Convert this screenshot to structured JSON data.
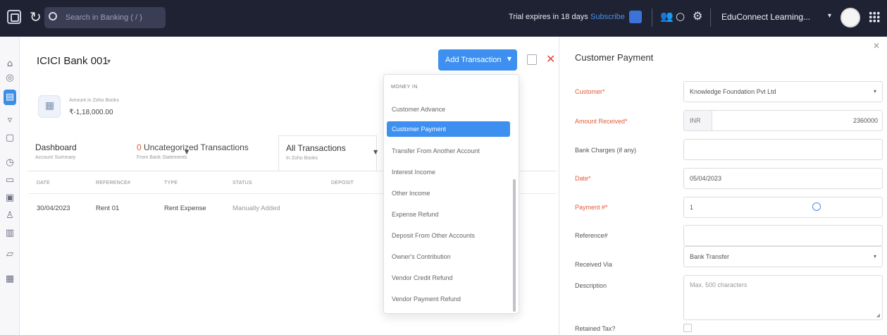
{
  "topbar": {
    "search_placeholder": "Search in Banking ( / )",
    "trial_text": "Trial expires in 18 days",
    "subscribe_label": "Subscribe",
    "org_name": "EduConnect Learning..."
  },
  "sidebar": {
    "icons": [
      "home-icon",
      "shop-icon",
      "bank-icon",
      "cart-icon",
      "bag-icon",
      "clock-icon",
      "receipt-icon",
      "doc-icon",
      "user-icon",
      "report-icon",
      "folder-icon",
      "settings-icon"
    ]
  },
  "main": {
    "bank_title": "ICICI Bank 001",
    "add_transaction_label": "Add Transaction",
    "balance_label": "Amount in Zoho Books",
    "balance_value": "₹-1,18,000.00",
    "tabs": [
      {
        "title": "Dashboard",
        "sub": "Account Summary"
      },
      {
        "count": "0",
        "title": "Uncategorized Transactions",
        "sub": "From Bank Statements"
      },
      {
        "title": "All Transactions",
        "sub": "In Zoho Books"
      }
    ],
    "table": {
      "headers": [
        "DATE",
        "REFERENCE#",
        "TYPE",
        "STATUS",
        "DEPOSIT"
      ],
      "rows": [
        {
          "date": "30/04/2023",
          "reference": "Rent 01",
          "type": "Rent Expense",
          "status": "Manually Added"
        }
      ]
    }
  },
  "dropdown": {
    "header": "MONEY IN",
    "items": [
      "Customer Advance",
      "Customer Payment",
      "Transfer From Another Account",
      "Interest Income",
      "Other Income",
      "Expense Refund",
      "Deposit From Other Accounts",
      "Owner's Contribution",
      "Vendor Credit Refund",
      "Vendor Payment Refund"
    ],
    "selected_index": 1
  },
  "panel": {
    "title": "Customer Payment",
    "fields": {
      "customer_label": "Customer*",
      "customer_value": "Knowledge Foundation Pvt Ltd",
      "amount_label": "Amount Received*",
      "amount_currency": "INR",
      "amount_value": "2360000",
      "bank_charges_label": "Bank Charges (if any)",
      "date_label": "Date*",
      "date_value": "05/04/2023",
      "payment_label": "Payment #*",
      "payment_value": "1",
      "reference_label": "Reference#",
      "received_via_label": "Received Via",
      "received_via_value": "Bank Transfer",
      "description_label": "Description",
      "description_placeholder": "Max. 500 characters",
      "tax_label": "Retained Tax?"
    }
  }
}
